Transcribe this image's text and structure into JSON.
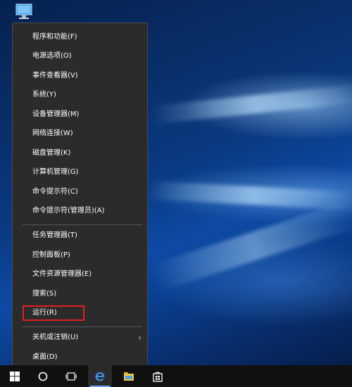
{
  "desktop": {
    "icon": "this-pc-icon"
  },
  "context_menu": {
    "items": [
      {
        "label": "程序和功能(F)"
      },
      {
        "label": "电源选项(O)"
      },
      {
        "label": "事件查看器(V)"
      },
      {
        "label": "系统(Y)"
      },
      {
        "label": "设备管理器(M)"
      },
      {
        "label": "网络连接(W)"
      },
      {
        "label": "磁盘管理(K)"
      },
      {
        "label": "计算机管理(G)"
      },
      {
        "label": "命令提示符(C)"
      },
      {
        "label": "命令提示符(管理员)(A)"
      },
      {
        "label": "任务管理器(T)"
      },
      {
        "label": "控制面板(P)"
      },
      {
        "label": "文件资源管理器(E)"
      },
      {
        "label": "搜索(S)"
      },
      {
        "label": "运行(R)",
        "highlighted": true
      },
      {
        "label": "关机或注销(U)",
        "has_submenu": true
      },
      {
        "label": "桌面(D)"
      }
    ],
    "submenu_arrow": "›",
    "highlight_color": "#e02020"
  },
  "taskbar": {
    "icons": [
      {
        "name": "windows-start-icon"
      },
      {
        "name": "cortana-search-icon"
      },
      {
        "name": "task-view-icon"
      },
      {
        "name": "edge-browser-icon",
        "active": true
      },
      {
        "name": "file-explorer-icon"
      },
      {
        "name": "store-icon"
      }
    ],
    "accent": "#6aa7ff"
  }
}
